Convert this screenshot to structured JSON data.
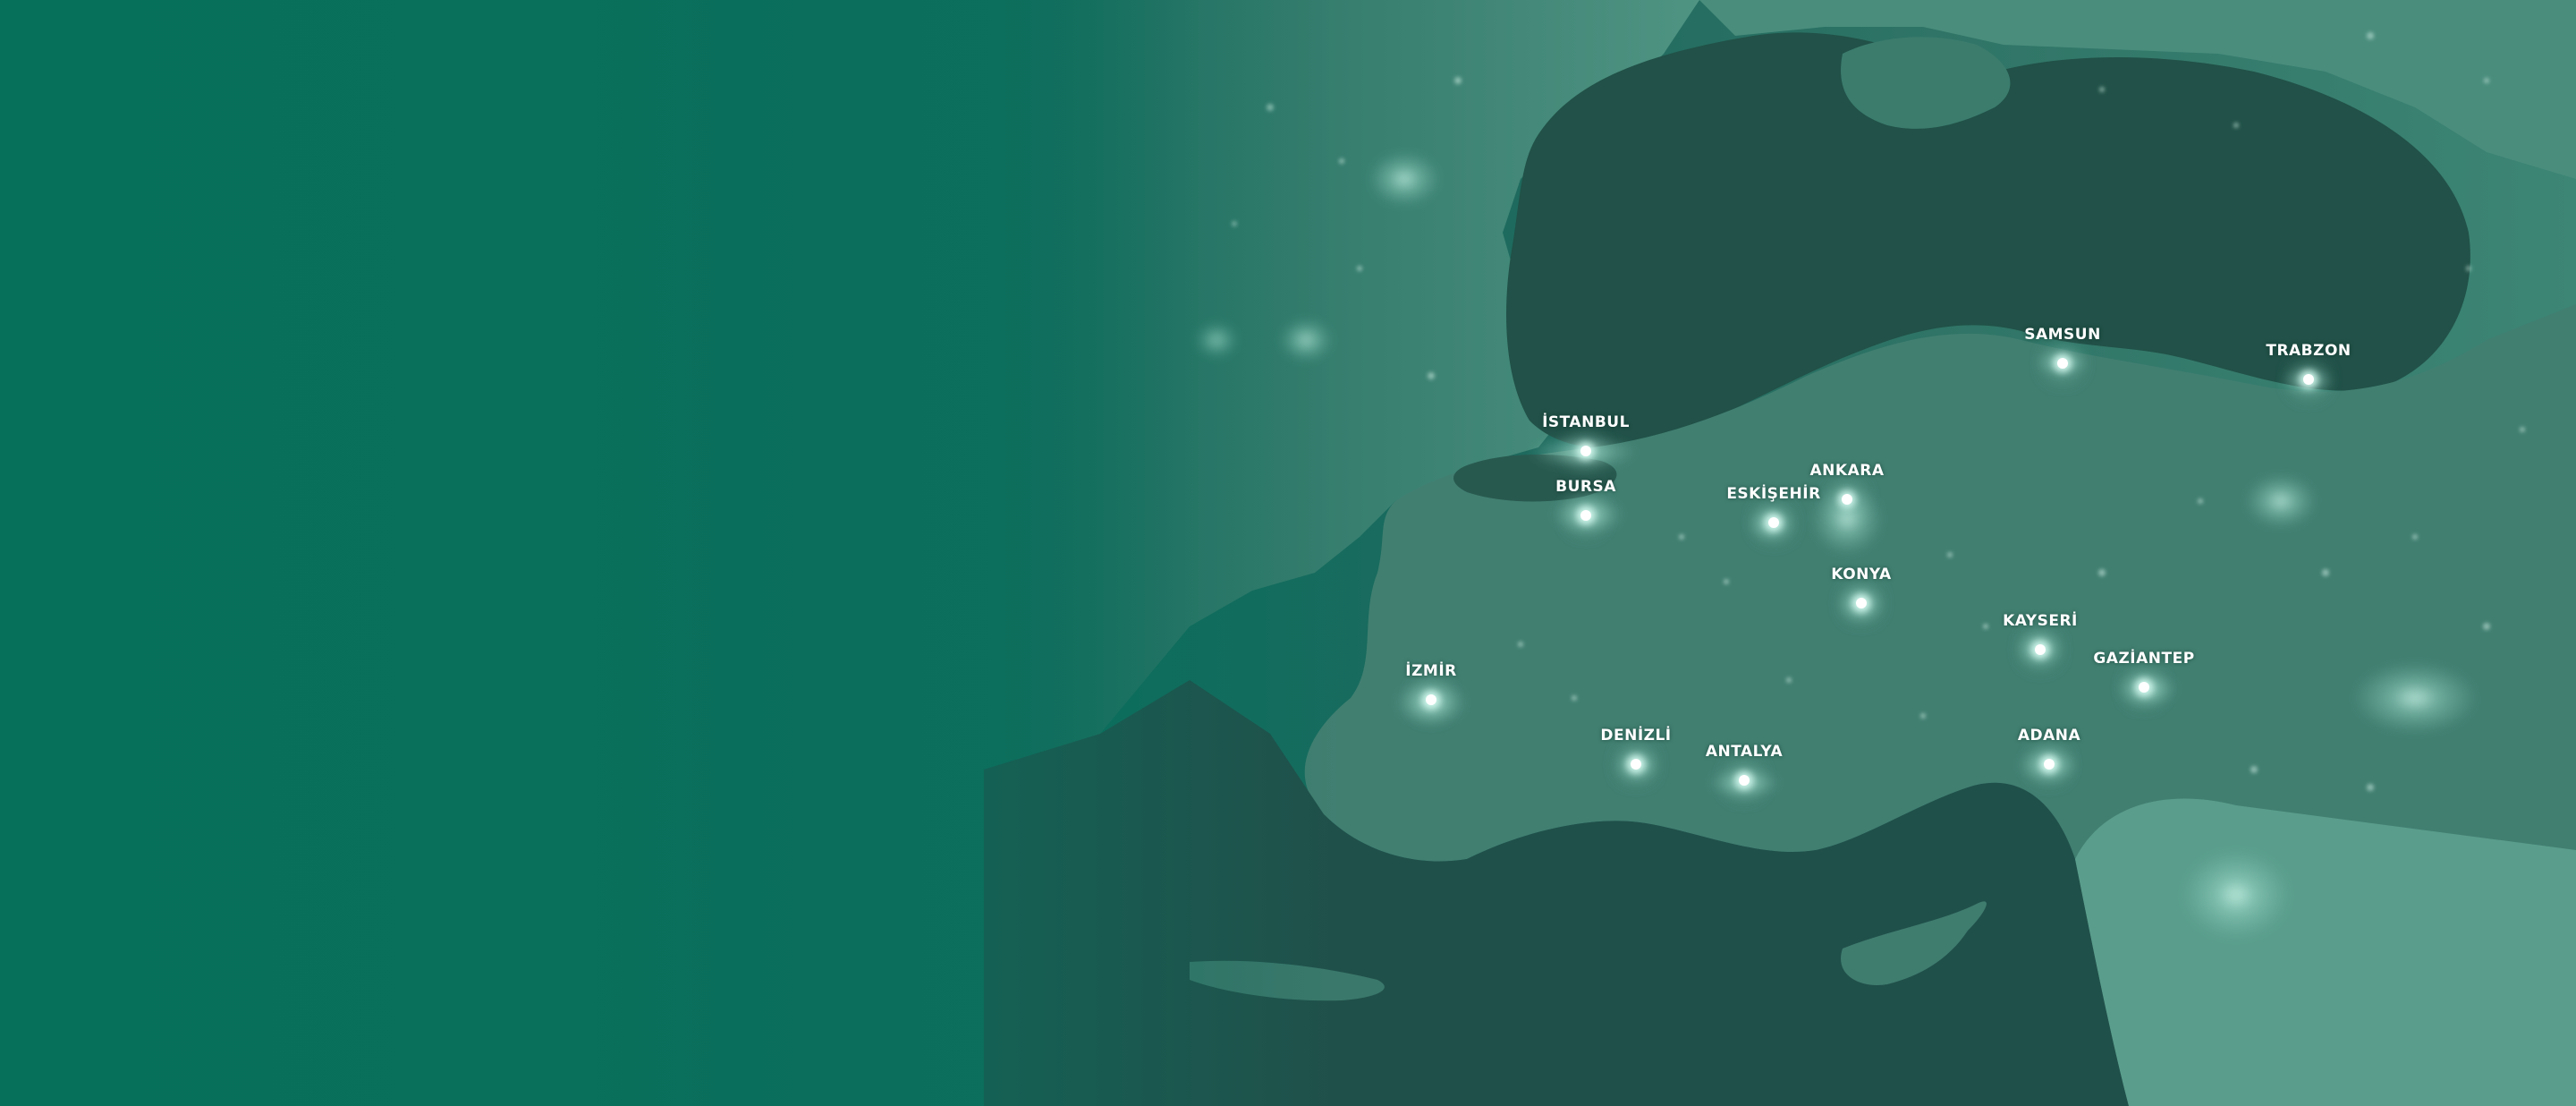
{
  "colors": {
    "background": "#0b6e5c",
    "sea": "#205248",
    "land": "#3f7e70",
    "city_light": "#bfeee0"
  },
  "map": {
    "cities": [
      {
        "key": "istanbul",
        "name": "İSTANBUL"
      },
      {
        "key": "bursa",
        "name": "BURSA"
      },
      {
        "key": "eskisehir",
        "name": "ESKİŞEHİR"
      },
      {
        "key": "ankara",
        "name": "ANKARA"
      },
      {
        "key": "konya",
        "name": "KONYA"
      },
      {
        "key": "samsun",
        "name": "SAMSUN"
      },
      {
        "key": "trabzon",
        "name": "TRABZON"
      },
      {
        "key": "kayseri",
        "name": "KAYSERİ"
      },
      {
        "key": "gaziantep",
        "name": "GAZİANTEP"
      },
      {
        "key": "adana",
        "name": "ADANA"
      },
      {
        "key": "izmir",
        "name": "İZMİR"
      },
      {
        "key": "denizli",
        "name": "DENİZLİ"
      },
      {
        "key": "antalya",
        "name": "ANTALYA"
      }
    ]
  }
}
